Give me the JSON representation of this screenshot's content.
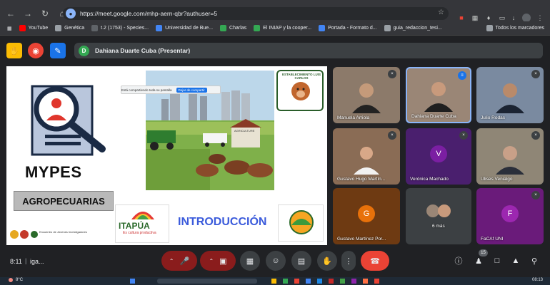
{
  "browser": {
    "url": "https://meet.google.com/mhp-aern-qbr?authuser=5",
    "bookmarks": [
      {
        "label": "YouTube",
        "color": "#ff0000"
      },
      {
        "label": "Genética",
        "color": "#9aa0a6"
      },
      {
        "label": "t.2 (1753) - Species...",
        "color": "#5f6368"
      },
      {
        "label": "Universidad de Bue...",
        "color": "#4285f4"
      },
      {
        "label": "Charlas",
        "color": "#34a853"
      },
      {
        "label": "El INIAP y la cooper...",
        "color": "#34a853"
      },
      {
        "label": "Portada - Formato d...",
        "color": "#4285f4"
      },
      {
        "label": "guia_redaccion_tesi...",
        "color": "#9aa0a6"
      }
    ],
    "all_bookmarks_label": "Todos los marcadores"
  },
  "meet_header": {
    "presenter_initial": "D",
    "presenter_label": "Dahiana Duarte Cuba (Presentar)"
  },
  "slide": {
    "title": "MYPES",
    "subtitle": "AGROPECUARIAS",
    "intro": "INTRODUCCIÓN",
    "itapua_logo": "ITAPÚA",
    "itapua_sub": "Es cultura productiva",
    "seal_text": "ESTABLECIMIENTO LUIS CARLOS",
    "share_tooltip": "Está compartiendo toda su pantalla",
    "share_stop": "Dejar de compartir",
    "footer_text": "Encuentro de Jóvenes Investigadores",
    "farm_sign": "AGRICULTURE",
    "accent": "#3b5bdb"
  },
  "participants": [
    {
      "name": "Manuela Arriola",
      "state": "muted"
    },
    {
      "name": "Dahiana Duarte Cuba",
      "state": "speaking"
    },
    {
      "name": "Julio Rodas",
      "state": "muted"
    },
    {
      "name": "Gustavo Hugo Martín...",
      "state": "muted"
    },
    {
      "name": "Verónica Machado",
      "state": "muted",
      "initial": "V",
      "color": "#7b1fa2"
    },
    {
      "name": "Ulises Venialgo",
      "state": "muted"
    },
    {
      "name": "Gustavo Martínez Por...",
      "state": "muted",
      "initial": "G",
      "color": "#e8710a"
    },
    {
      "name": "6 más",
      "state": "more"
    },
    {
      "name": "FaCAf UNI",
      "state": "muted",
      "initial": "F",
      "color": "#9c27b0"
    }
  ],
  "controls": {
    "time": "8:11",
    "separator": "|",
    "meeting_code": "iga...",
    "participants_count": "15"
  },
  "taskbar": {
    "temperature": "8°C",
    "clock": "08:13"
  }
}
